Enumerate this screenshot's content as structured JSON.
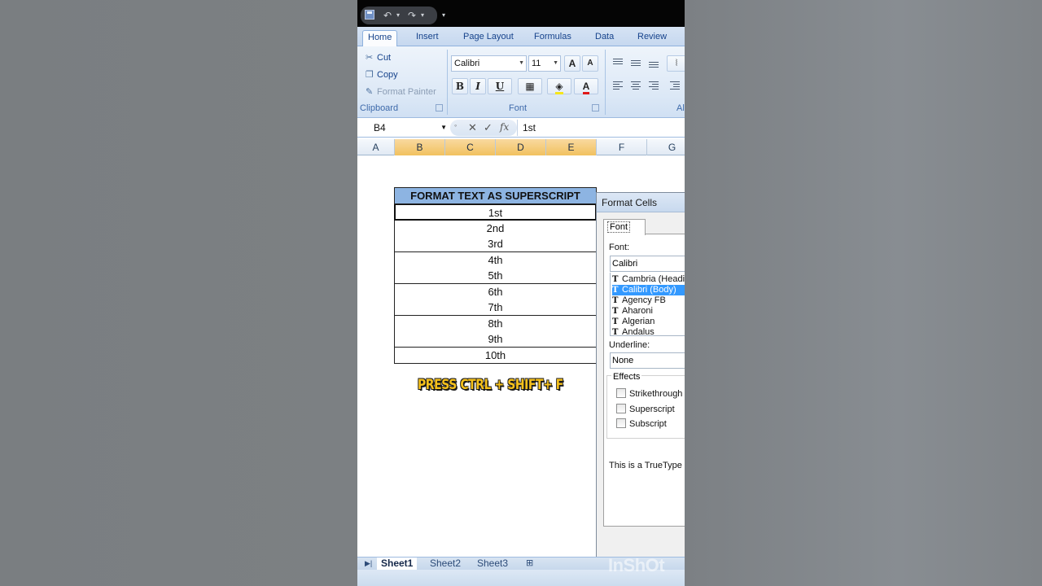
{
  "qat": {
    "undo": "↶",
    "redo": "↷",
    "more": "▾"
  },
  "ribbon": {
    "tabs": [
      "Home",
      "Insert",
      "Page Layout",
      "Formulas",
      "Data",
      "Review"
    ],
    "clipboard": {
      "cut": "Cut",
      "copy": "Copy",
      "format_painter": "Format Painter",
      "label": "Clipboard"
    },
    "font": {
      "name": "Calibri",
      "size": "11",
      "bold": "B",
      "italic": "I",
      "underline": "U",
      "font_color_letter": "A",
      "label": "Font"
    },
    "alignment_label": "Al"
  },
  "formula_bar": {
    "name_box": "B4",
    "content": "1st",
    "fx": "fx"
  },
  "columns": [
    "A",
    "B",
    "C",
    "D",
    "E",
    "F",
    "G"
  ],
  "table": {
    "header": "FORMAT TEXT AS SUPERSCRIPT",
    "rows": [
      "1st",
      "2nd",
      "3rd",
      "4th",
      "5th",
      "6th",
      "7th",
      "8th",
      "9th",
      "10th"
    ]
  },
  "overlay_text": "PRESS CTRL + SHIFT+ F",
  "dialog": {
    "title": "Format Cells",
    "tab": "Font",
    "font_label": "Font:",
    "font_value": "Calibri",
    "font_list": [
      "Cambria (Headin",
      "Calibri (Body)",
      "Agency FB",
      "Aharoni",
      "Algerian",
      "Andalus"
    ],
    "selected_font": "Calibri (Body)",
    "underline_label": "Underline:",
    "underline_value": "None",
    "effects_label": "Effects",
    "effects": [
      "Strikethrough",
      "Superscript",
      "Subscript"
    ],
    "note": "This is a TrueType f"
  },
  "sheets": [
    "Sheet1",
    "Sheet2",
    "Sheet3"
  ],
  "active_sheet": "Sheet1",
  "watermark": "InShOt",
  "colors": {
    "header_fill": "#8db4e2",
    "selected_col": "#f1c15f",
    "overlay_text": "#f6c11c",
    "list_selection": "#3399ff"
  }
}
